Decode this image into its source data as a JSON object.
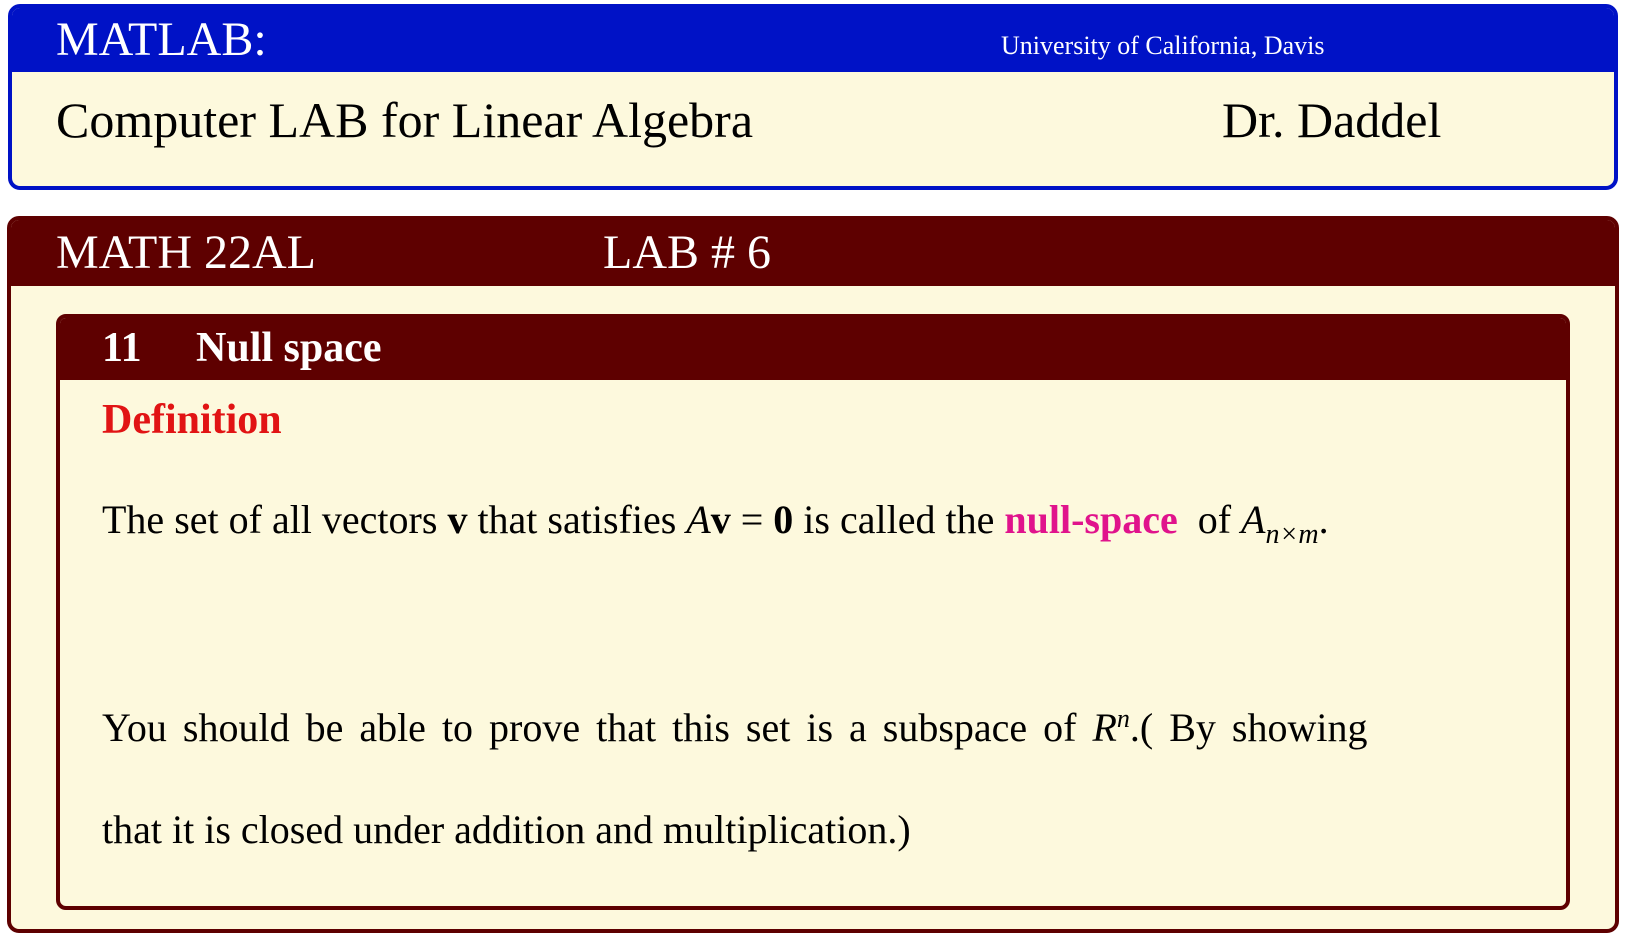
{
  "header": {
    "title": "MATLAB:",
    "university": "University of California, Davis",
    "course_name": "Computer LAB for Linear Algebra",
    "instructor": "Dr. Daddel"
  },
  "lab": {
    "course_code": "MATH 22AL",
    "lab_number": "LAB # 6"
  },
  "section": {
    "number": "11",
    "title": "Null space",
    "definition_label": "Definition",
    "definition": {
      "part1": "The set of all vectors ",
      "vector": "v",
      "part2": " that satisfies ",
      "matrix": "A",
      "vector2": "v",
      "equals": " = ",
      "zero": "0",
      "part3": " is called the ",
      "term": "null-space",
      "part4": "  of ",
      "matrix2": "A",
      "subscript": "n×m",
      "period": "."
    },
    "paragraph": {
      "line1_text": "You should be able to prove that this set is a subspace of ",
      "space": "R",
      "superscript": "n",
      "line1_tail": ".( By showing",
      "line2": "that it is closed under addition and multiplication.)"
    }
  },
  "colors": {
    "header_blue": "#0012c6",
    "maroon": "#5e0000",
    "background": "#fdf9dd",
    "definition_red": "#e11414",
    "term_magenta": "#e0138c"
  }
}
